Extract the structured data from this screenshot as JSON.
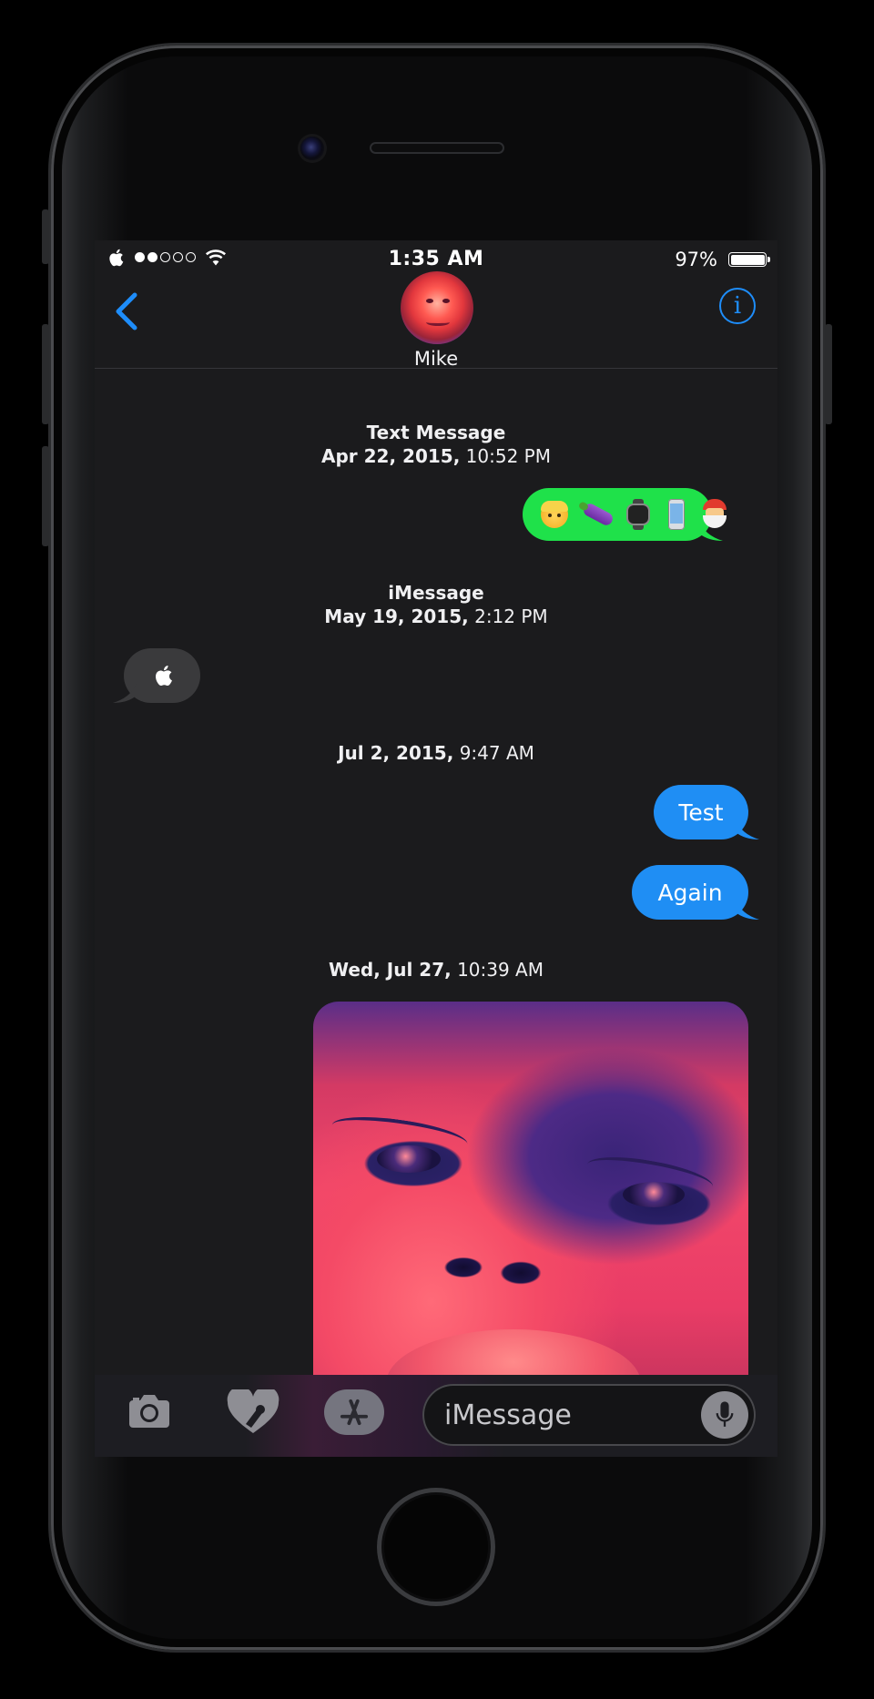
{
  "status_bar": {
    "time": "1:35 AM",
    "battery": "97%",
    "signal_filled": 2,
    "signal_total": 5
  },
  "nav": {
    "contact_name": "Mike",
    "info_label": "i"
  },
  "messages": [
    {
      "type": "stamp",
      "service": "Text Message",
      "date": "Apr 22, 2015,",
      "time": "10:52 PM"
    },
    {
      "type": "bubble",
      "direction": "outgoing",
      "color": "#1fe14a",
      "content_icons": [
        "blond-man-emoji",
        "eggplant-emoji",
        "watch-emoji",
        "mobile-phone-emoji",
        "santa-emoji"
      ]
    },
    {
      "type": "stamp",
      "service": "iMessage",
      "date": "May 19, 2015,",
      "time": "2:12 PM"
    },
    {
      "type": "bubble",
      "direction": "incoming",
      "color": "#3a3a3c",
      "content_icons": [
        "apple-logo-icon"
      ]
    },
    {
      "type": "stamp",
      "date": "Jul 2, 2015,",
      "time": "9:47 AM"
    },
    {
      "type": "bubble",
      "direction": "outgoing",
      "color": "#1f8ef4",
      "text": "Test"
    },
    {
      "type": "bubble",
      "direction": "outgoing",
      "color": "#1f8ef4",
      "text": "Again"
    },
    {
      "type": "stamp",
      "date": "Wed, Jul 27,",
      "time": "10:39 AM"
    },
    {
      "type": "photo",
      "direction": "outgoing"
    }
  ],
  "toolbar": {
    "input_placeholder": "iMessage",
    "icons": [
      "camera-icon",
      "digital-touch-icon",
      "app-store-icon",
      "microphone-icon"
    ]
  },
  "colors": {
    "accent": "#1e8dfa",
    "sms_green": "#1fe14a",
    "imessage_blue": "#1f8ef4",
    "background": "#1b1b1d"
  }
}
